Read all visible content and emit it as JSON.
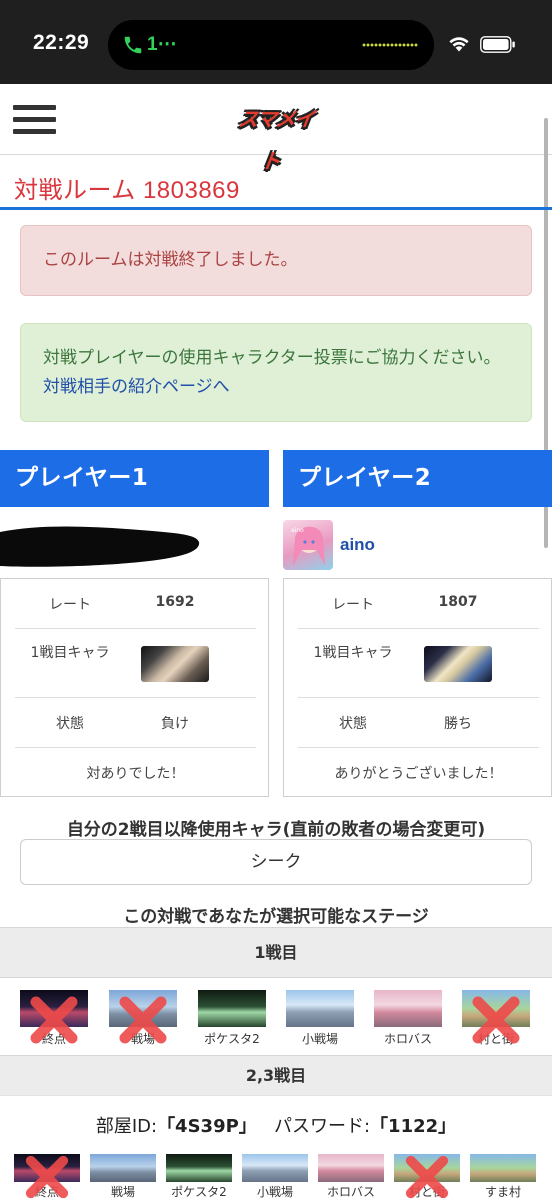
{
  "status_bar": {
    "time": "22:29",
    "call_indicator": "1⋯",
    "icons": [
      "phone-icon",
      "wifi-icon",
      "battery-icon"
    ]
  },
  "header": {
    "logo_text": "スマメイト",
    "menu_icon": "hamburger-menu-icon"
  },
  "room": {
    "title": "対戦ルーム 1803869"
  },
  "alerts": {
    "ended": "このルームは対戦終了しました。",
    "vote_text": "対戦プレイヤーの使用キャラクター投票にご協力ください。",
    "vote_link": "対戦相手の紹介ページへ"
  },
  "players": [
    {
      "heading": "プレイヤー1",
      "name": "",
      "rate_label": "レート",
      "rate": "1692",
      "char_label": "1戦目キャラ",
      "state_label": "状態",
      "state": "負け",
      "message": "対ありでした！"
    },
    {
      "heading": "プレイヤー2",
      "name": "aino",
      "avatar_text": "aino",
      "rate_label": "レート",
      "rate": "1807",
      "char_label": "1戦目キャラ",
      "state_label": "状態",
      "state": "勝ち",
      "message": "ありがとうございました！"
    }
  ],
  "character_select": {
    "label": "自分の2戦目以降使用キャラ(直前の敗者の場合変更可)",
    "value": "シーク"
  },
  "stages": {
    "label": "この対戦であなたが選択可能なステージ",
    "round1_label": "1戦目",
    "round23_label": "2,3戦目",
    "round1": [
      {
        "name": "終点",
        "banned": true
      },
      {
        "name": "戦場",
        "banned": true
      },
      {
        "name": "ポケスタ2",
        "banned": false
      },
      {
        "name": "小戦場",
        "banned": false
      },
      {
        "name": "ホロバス",
        "banned": false
      },
      {
        "name": "村と街",
        "banned": true
      }
    ],
    "round23": [
      {
        "name": "終点",
        "banned": true
      },
      {
        "name": "戦場",
        "banned": false
      },
      {
        "name": "ポケスタ2",
        "banned": false
      },
      {
        "name": "小戦場",
        "banned": false
      },
      {
        "name": "ホロバス",
        "banned": false
      },
      {
        "name": "村と街",
        "banned": true
      },
      {
        "name": "すま村",
        "banned": false
      }
    ]
  },
  "room_info": {
    "id_label": "部屋ID:",
    "id_value": "「4S39P」",
    "password_label": "パスワード:",
    "password_value": "「1122」"
  },
  "colors": {
    "accent_blue": "#1d6ee6",
    "title_red": "#d9363e",
    "ban_red": "#ee4a4a"
  }
}
